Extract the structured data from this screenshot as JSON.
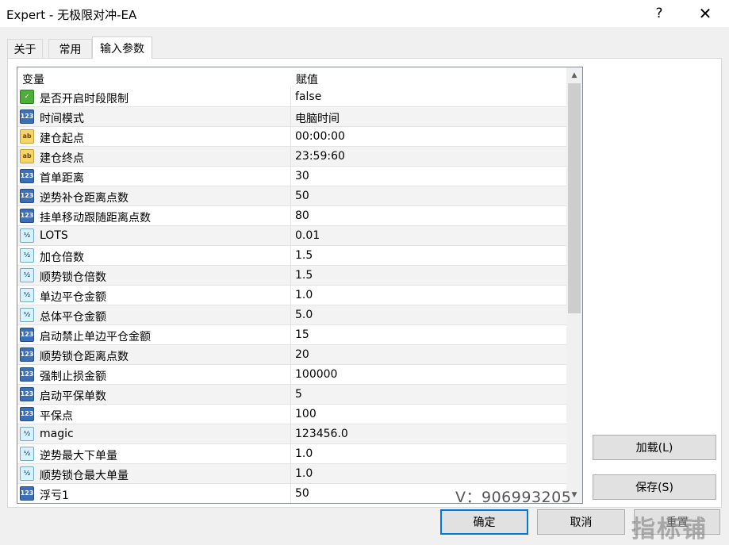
{
  "window": {
    "title": "Expert - 无极限对冲-EA",
    "help_label": "?",
    "close_label": "✕"
  },
  "tabs": [
    {
      "label": "关于"
    },
    {
      "label": "常用"
    },
    {
      "label": "输入参数",
      "active": true
    }
  ],
  "table": {
    "col_variable": "变量",
    "col_value": "赋值",
    "rows": [
      {
        "type": "bool",
        "icon_text": "✓",
        "name": "是否开启时段限制",
        "value": "false"
      },
      {
        "type": "int",
        "icon_text": "123",
        "name": "时间模式",
        "value": "电脑时间"
      },
      {
        "type": "string",
        "icon_text": "ab",
        "name": "建仓起点",
        "value": "00:00:00"
      },
      {
        "type": "string",
        "icon_text": "ab",
        "name": "建仓终点",
        "value": "23:59:60"
      },
      {
        "type": "int",
        "icon_text": "123",
        "name": "首单距离",
        "value": "30"
      },
      {
        "type": "int",
        "icon_text": "123",
        "name": "逆势补仓距离点数",
        "value": "50"
      },
      {
        "type": "int",
        "icon_text": "123",
        "name": "挂单移动跟随距离点数",
        "value": "80"
      },
      {
        "type": "double",
        "icon_text": "½",
        "name": "LOTS",
        "value": "0.01"
      },
      {
        "type": "double",
        "icon_text": "½",
        "name": "加仓倍数",
        "value": "1.5"
      },
      {
        "type": "double",
        "icon_text": "½",
        "name": "顺势锁仓倍数",
        "value": "1.5"
      },
      {
        "type": "double",
        "icon_text": "½",
        "name": "单边平仓金额",
        "value": "1.0"
      },
      {
        "type": "double",
        "icon_text": "½",
        "name": "总体平仓金额",
        "value": "5.0"
      },
      {
        "type": "int",
        "icon_text": "123",
        "name": "启动禁止单边平仓金额",
        "value": "15"
      },
      {
        "type": "int",
        "icon_text": "123",
        "name": "顺势锁仓距离点数",
        "value": "20"
      },
      {
        "type": "int",
        "icon_text": "123",
        "name": "强制止损金额",
        "value": "100000"
      },
      {
        "type": "int",
        "icon_text": "123",
        "name": "启动平保单数",
        "value": "5"
      },
      {
        "type": "int",
        "icon_text": "123",
        "name": "平保点",
        "value": "100"
      },
      {
        "type": "double",
        "icon_text": "½",
        "name": "magic",
        "value": "123456.0"
      },
      {
        "type": "double",
        "icon_text": "½",
        "name": "逆势最大下单量",
        "value": "1.0"
      },
      {
        "type": "double",
        "icon_text": "½",
        "name": "顺势锁仓最大单量",
        "value": "1.0"
      },
      {
        "type": "int",
        "icon_text": "123",
        "name": "浮亏1",
        "value": "50"
      }
    ]
  },
  "scrollbar": {
    "up_icon": "▲",
    "down_icon": "▼",
    "position_fraction": 0.0
  },
  "watermark_text": "V：906993205",
  "logo_watermark": "指标铺",
  "buttons": {
    "load": "加载(L)",
    "save": "保存(S)",
    "ok": "确定",
    "cancel": "取消",
    "reset": "重置"
  },
  "colors": {
    "accent": "#0078d7",
    "bool_icon": "#4fae3a",
    "int_icon": "#3d6fb6",
    "string_icon": "#f5d46a",
    "double_icon": "#d9f1fb"
  }
}
